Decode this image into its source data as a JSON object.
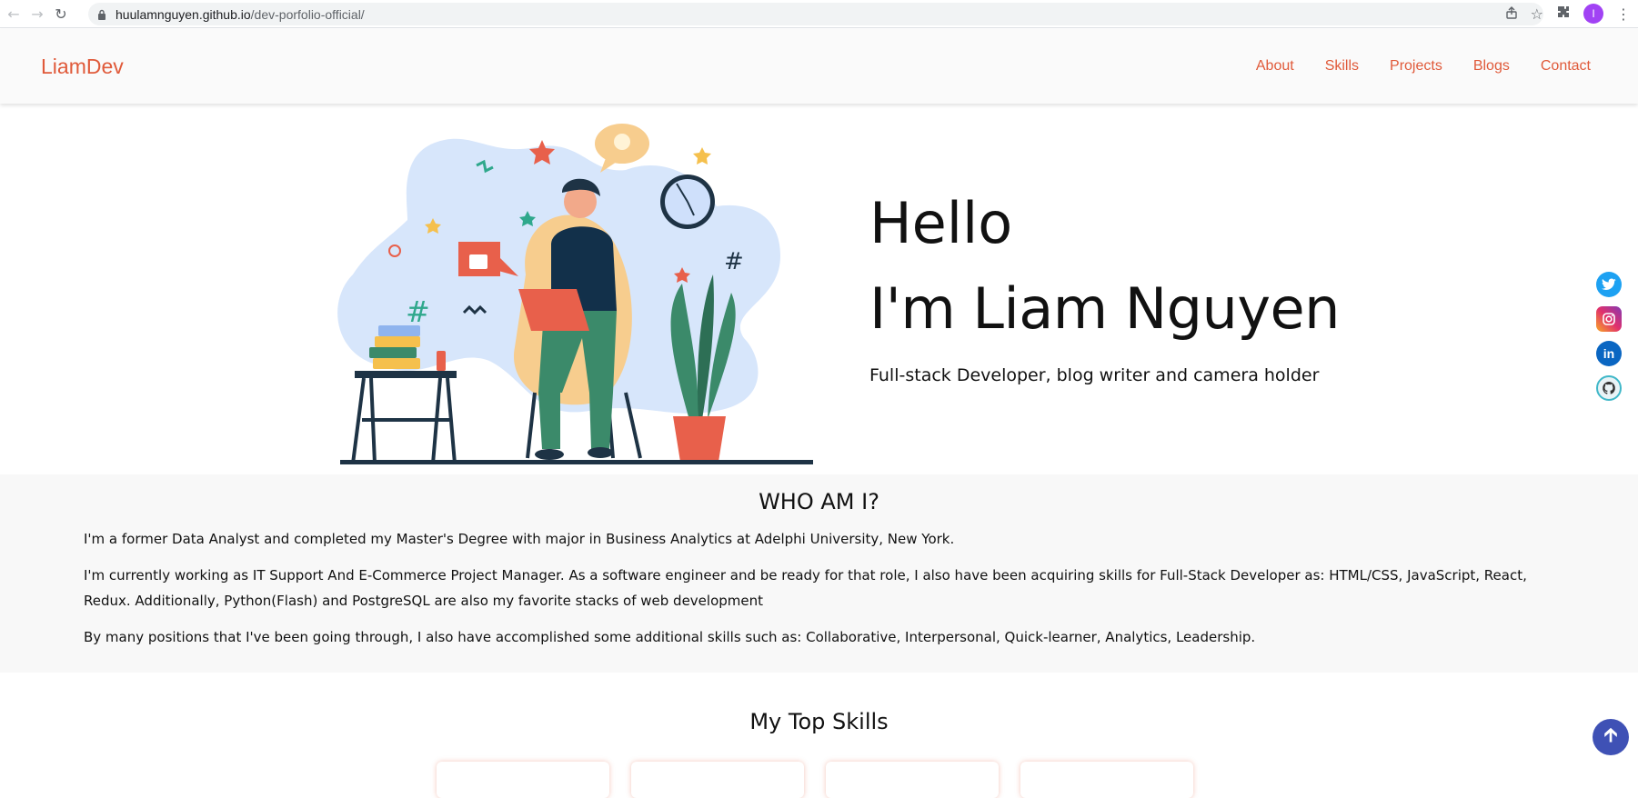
{
  "browser": {
    "url_host": "huulamnguyen.github.io",
    "url_path": "/dev-porfolio-official/",
    "profile_initial": "I"
  },
  "header": {
    "logo": "LiamDev",
    "nav": [
      "About",
      "Skills",
      "Projects",
      "Blogs",
      "Contact"
    ]
  },
  "hero": {
    "greeting": "Hello",
    "name": "I'm Liam Nguyen",
    "tagline": "Full-stack Developer, blog writer and camera holder"
  },
  "social": [
    "twitter-icon",
    "instagram-icon",
    "linkedin-icon",
    "github-icon"
  ],
  "about": {
    "title": "WHO AM I?",
    "p1": "I'm a former Data Analyst and completed my Master's Degree with major in Business Analytics at Adelphi University, New York.",
    "p2": "I'm currently working as IT Support And E-Commerce Project Manager. As a software engineer and be ready for that role, I also have been acquiring skills for Full-Stack Developer as: HTML/CSS, JavaScript, React, Redux. Additionally, Python(Flash) and PostgreSQL are also my favorite stacks of web development",
    "p3": "By many positions that I've been going through, I also have accomplished some additional skills such as: Collaborative, Interpersonal, Quick-learner, Analytics, Leadership."
  },
  "skills": {
    "title": "My Top Skills"
  },
  "colors": {
    "accent": "#e05a3a",
    "scroll_button": "#3f51b5"
  }
}
